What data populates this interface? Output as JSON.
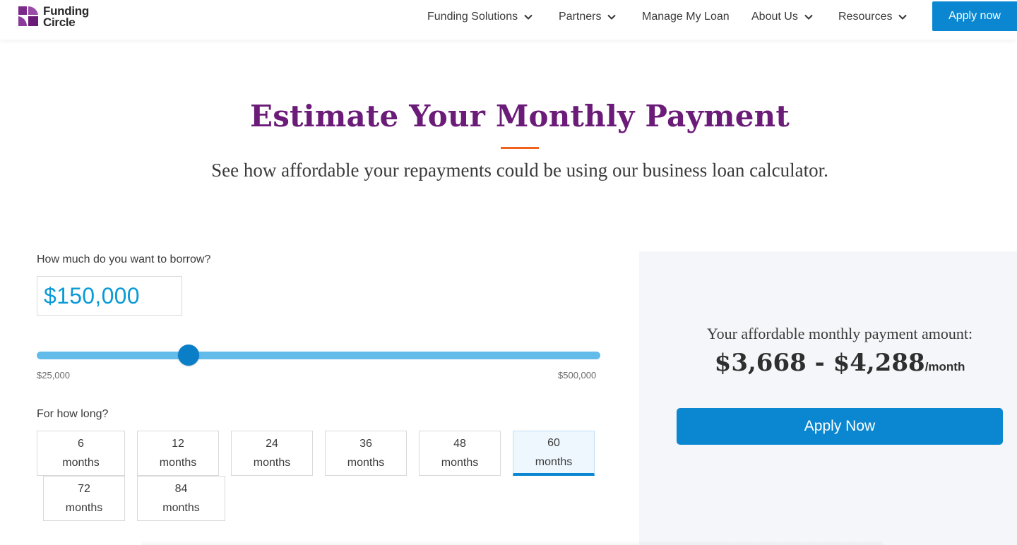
{
  "header": {
    "logo_line1": "Funding",
    "logo_line2": "Circle",
    "nav": [
      "Funding Solutions",
      "Partners",
      "Manage My Loan",
      "About Us",
      "Resources"
    ],
    "apply_label": "Apply now"
  },
  "hero": {
    "title": "Estimate Your Monthly Payment",
    "subtitle": "See how affordable your repayments could be using our business loan calculator."
  },
  "calculator": {
    "amount_question": "How much do you want to borrow?",
    "amount_value": "$150,000",
    "slider": {
      "min_label": "$25,000",
      "max_label": "$500,000",
      "value_fraction": 0.27
    },
    "term_question": "For how long?",
    "terms": [
      {
        "num": "6",
        "unit": "months"
      },
      {
        "num": "12",
        "unit": "months"
      },
      {
        "num": "24",
        "unit": "months"
      },
      {
        "num": "36",
        "unit": "months"
      },
      {
        "num": "48",
        "unit": "months"
      },
      {
        "num": "60",
        "unit": "months"
      },
      {
        "num": "72",
        "unit": "months"
      },
      {
        "num": "84",
        "unit": "months"
      }
    ],
    "selected_term": "60"
  },
  "result": {
    "label": "Your affordable monthly payment amount:",
    "amount": "$3,668 - $4,288",
    "per": "/month",
    "apply_label": "Apply Now"
  },
  "colors": {
    "brand_purple": "#6b1b78",
    "accent_orange": "#f0631f",
    "primary_blue": "#0a87d0",
    "slider_track": "#63bbea"
  }
}
